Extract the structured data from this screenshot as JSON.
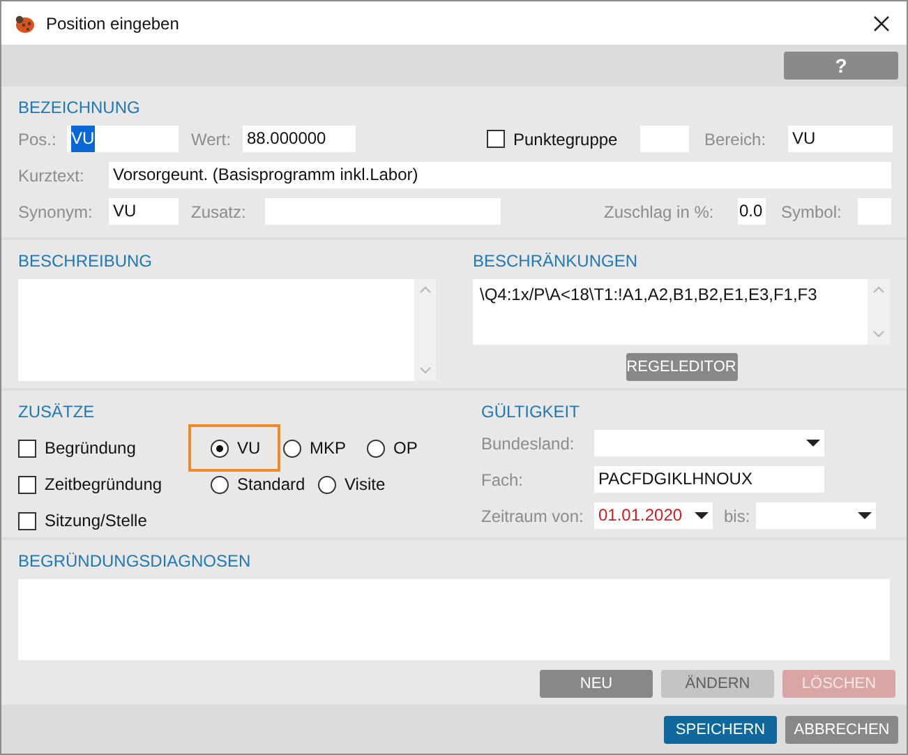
{
  "window": {
    "title": "Position eingeben"
  },
  "toolbar": {
    "help_button": "?"
  },
  "bezeichnung": {
    "heading": "BEZEICHNUNG",
    "pos": {
      "label": "Pos.:",
      "value": "VU",
      "text_selected": true
    },
    "wert": {
      "label": "Wert:",
      "value": "88.000000"
    },
    "punktegruppe": {
      "label": "Punktegruppe",
      "checked": false
    },
    "bereich": {
      "label": "Bereich:",
      "value": "VU"
    },
    "kurztext": {
      "label": "Kurztext:",
      "value": "Vorsorgeunt. (Basisprogramm inkl.Labor)"
    },
    "synonym": {
      "label": "Synonym:",
      "value": "VU"
    },
    "zusatz": {
      "label": "Zusatz:"
    },
    "zuschlag": {
      "label": "Zuschlag in %:",
      "value": "0.0"
    },
    "symbol": {
      "label": "Symbol:"
    }
  },
  "beschreibung": {
    "heading": "BESCHREIBUNG"
  },
  "beschraenkungen": {
    "heading": "BESCHRÄNKUNGEN",
    "value": "\\Q4:1x/P\\A<18\\T1:!A1,A2,B1,B2,E1,E3,F1,F3",
    "button": "REGELEDITOR"
  },
  "zusaetze": {
    "heading": "ZUSÄTZE",
    "checkboxes": [
      {
        "label": "Begründung",
        "checked": false
      },
      {
        "label": "Zeitbegründung",
        "checked": false
      },
      {
        "label": "Sitzung/Stelle",
        "checked": false
      }
    ],
    "radios_row_1": [
      {
        "label": "VU",
        "selected": true,
        "highlighted": true
      },
      {
        "label": "MKP",
        "selected": false,
        "highlighted": false
      },
      {
        "label": "OP",
        "selected": false,
        "highlighted": false
      }
    ],
    "radios_row_2": [
      {
        "label": "Standard",
        "selected": false,
        "highlighted": false
      },
      {
        "label": "Visite",
        "selected": false,
        "highlighted": false
      }
    ]
  },
  "gueltigkeit": {
    "heading": "GÜLTIGKEIT",
    "bundesland": {
      "label": "Bundesland:"
    },
    "fach": {
      "label": "Fach:",
      "value": "PACFDGIKLHNOUX"
    },
    "zeitraum_von": {
      "label": "Zeitraum von:",
      "value": "01.01.2020",
      "invalid": true
    },
    "bis": {
      "label": "bis:"
    }
  },
  "diagnosen": {
    "heading": "BEGRÜNDUNGSDIAGNOSEN",
    "buttons": [
      {
        "label": "NEU",
        "kind": "neutral",
        "disabled": false
      },
      {
        "label": "ÄNDERN",
        "kind": "neutral",
        "disabled": true
      },
      {
        "label": "LÖSCHEN",
        "kind": "danger",
        "disabled": true
      }
    ]
  },
  "footer": {
    "buttons": [
      {
        "label": "SPEICHERN",
        "kind": "primary",
        "disabled": false
      },
      {
        "label": "ABBRECHEN",
        "kind": "neutral",
        "disabled": false
      }
    ]
  }
}
